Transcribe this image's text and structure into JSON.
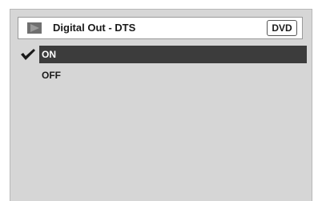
{
  "header": {
    "title": "Digital Out - DTS",
    "badge": "DVD",
    "icon": "play-icon"
  },
  "options": [
    {
      "label": "ON",
      "selected": true
    },
    {
      "label": "OFF",
      "selected": false
    }
  ],
  "colors": {
    "panel": "#d6d6d6",
    "highlight": "#3c3c3c",
    "header_bg": "#ffffff",
    "icon": "#6f6f6f"
  }
}
